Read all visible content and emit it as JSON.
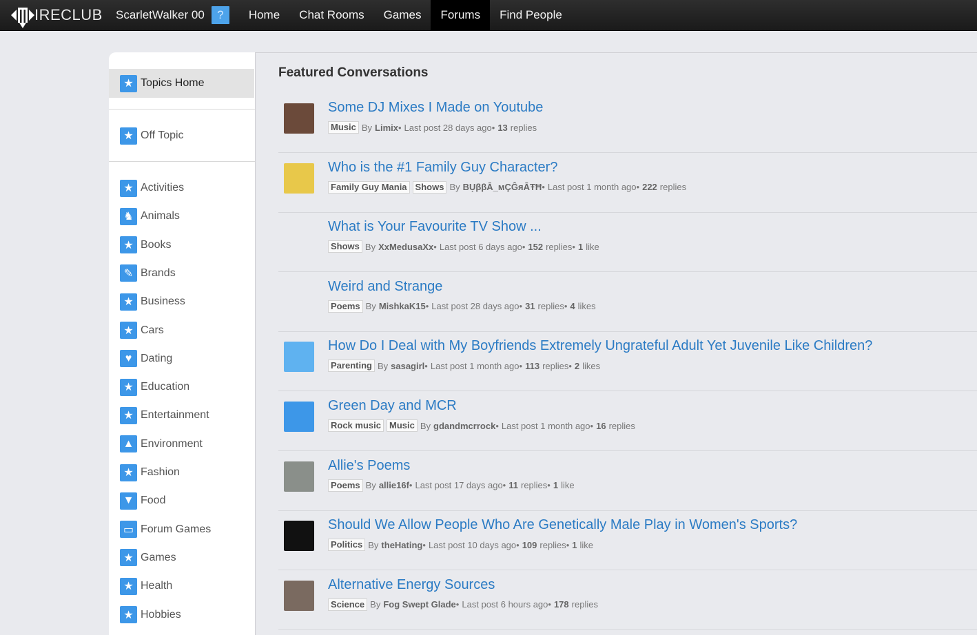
{
  "topbar": {
    "logo_text": "IRECLUB",
    "username": "ScarletWalker 00",
    "help": "?",
    "nav": [
      {
        "label": "Home",
        "active": false
      },
      {
        "label": "Chat Rooms",
        "active": false
      },
      {
        "label": "Games",
        "active": false
      },
      {
        "label": "Forums",
        "active": true
      },
      {
        "label": "Find People",
        "active": false
      }
    ]
  },
  "sidebar": {
    "topics_home": "Topics Home",
    "off_topic": "Off Topic",
    "items": [
      {
        "label": "Activities",
        "icon": "star-icon"
      },
      {
        "label": "Animals",
        "icon": "dog-icon"
      },
      {
        "label": "Books",
        "icon": "star-icon"
      },
      {
        "label": "Brands",
        "icon": "pen-icon"
      },
      {
        "label": "Business",
        "icon": "star-icon"
      },
      {
        "label": "Cars",
        "icon": "star-icon"
      },
      {
        "label": "Dating",
        "icon": "heart-icon"
      },
      {
        "label": "Education",
        "icon": "star-icon"
      },
      {
        "label": "Entertainment",
        "icon": "star-icon"
      },
      {
        "label": "Environment",
        "icon": "tree-icon"
      },
      {
        "label": "Fashion",
        "icon": "star-icon"
      },
      {
        "label": "Food",
        "icon": "pizza-icon"
      },
      {
        "label": "Forum Games",
        "icon": "speech-bubble-icon"
      },
      {
        "label": "Games",
        "icon": "star-icon"
      },
      {
        "label": "Health",
        "icon": "star-icon"
      },
      {
        "label": "Hobbies",
        "icon": "star-icon"
      }
    ]
  },
  "main": {
    "title": "Featured Conversations",
    "threads": [
      {
        "title": "Some DJ Mixes I Made on Youtube",
        "tags": [
          "Music"
        ],
        "by": "By",
        "author": "Limix",
        "last_post": "Last post 28 days ago",
        "replies_count": "13",
        "replies_label": "replies",
        "likes_count": "",
        "likes_label": "",
        "avatar_color": "#6b4a3a"
      },
      {
        "title": "Who is the #1 Family Guy Character?",
        "tags": [
          "Family Guy Mania",
          "Shows"
        ],
        "by": "By",
        "author": "ΒỤββĀ_мÇĜяĀŦĦ",
        "last_post": "Last post 1 month ago",
        "replies_count": "222",
        "replies_label": "replies",
        "likes_count": "",
        "likes_label": "",
        "avatar_color": "#e8c84a"
      },
      {
        "title": "What is Your Favourite TV Show ...",
        "tags": [
          "Shows"
        ],
        "by": "By",
        "author": "XxMedusaXx",
        "last_post": "Last post 6 days ago",
        "replies_count": "152",
        "replies_label": "replies",
        "likes_count": "1",
        "likes_label": "like",
        "avatar_color": ""
      },
      {
        "title": "Weird and Strange",
        "tags": [
          "Poems"
        ],
        "by": "By",
        "author": "MishkaK15",
        "last_post": "Last post 28 days ago",
        "replies_count": "31",
        "replies_label": "replies",
        "likes_count": "4",
        "likes_label": "likes",
        "avatar_color": ""
      },
      {
        "title": "How Do I Deal with My Boyfriends Extremely Ungrateful Adult Yet Juvenile Like Children?",
        "tags": [
          "Parenting"
        ],
        "by": "By",
        "author": "sasagirl",
        "last_post": "Last post 1 month ago",
        "replies_count": "113",
        "replies_label": "replies",
        "likes_count": "2",
        "likes_label": "likes",
        "avatar_color": "#5fb2f0"
      },
      {
        "title": "Green Day and MCR",
        "tags": [
          "Rock music",
          "Music"
        ],
        "by": "By",
        "author": "gdandmcrrock",
        "last_post": "Last post 1 month ago",
        "replies_count": "16",
        "replies_label": "replies",
        "likes_count": "",
        "likes_label": "",
        "avatar_color": "#3d97e8"
      },
      {
        "title": "Allie's Poems",
        "tags": [
          "Poems"
        ],
        "by": "By",
        "author": "allie16f",
        "last_post": "Last post 17 days ago",
        "replies_count": "11",
        "replies_label": "replies",
        "likes_count": "1",
        "likes_label": "like",
        "avatar_color": "#8a8f8a"
      },
      {
        "title": "Should We Allow People Who Are Genetically Male Play in Women's Sports?",
        "tags": [
          "Politics"
        ],
        "by": "By",
        "author": "theHating",
        "last_post": "Last post 10 days ago",
        "replies_count": "109",
        "replies_label": "replies",
        "likes_count": "1",
        "likes_label": "like",
        "avatar_color": "#111111"
      },
      {
        "title": "Alternative Energy Sources",
        "tags": [
          "Science"
        ],
        "by": "By",
        "author": "Fog Swept Glade",
        "last_post": "Last post 6 hours ago",
        "replies_count": "178",
        "replies_label": "replies",
        "likes_count": "",
        "likes_label": "",
        "avatar_color": "#7a6a60"
      }
    ]
  },
  "colors": {
    "link": "#2b7bc4",
    "icon_blue": "#3d97e8",
    "topbar": "#1f1f1f",
    "bg": "#e9eaee"
  }
}
